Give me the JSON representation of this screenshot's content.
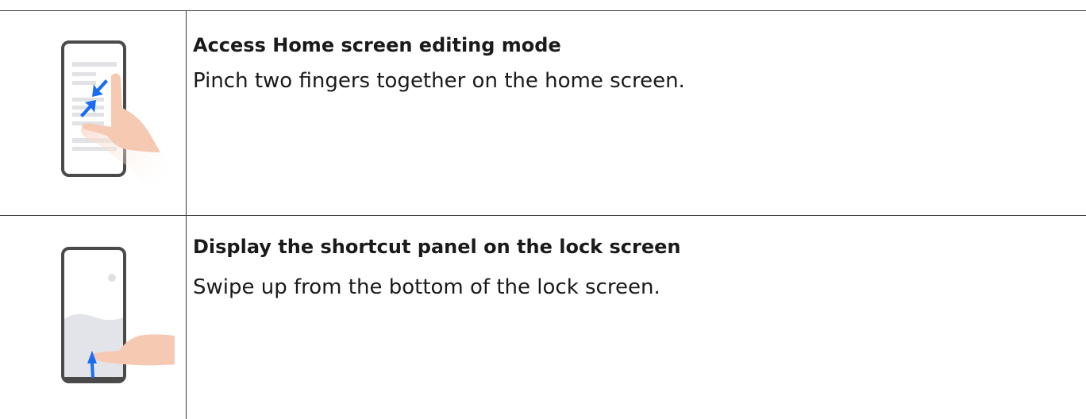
{
  "rows": [
    {
      "title": "Access Home screen editing mode",
      "description": "Pinch two fingers together on the home screen.",
      "icon": "pinch-gesture-icon"
    },
    {
      "title": "Display the shortcut panel on the lock screen",
      "description": "Swipe up from the bottom of the lock screen.",
      "icon": "swipe-up-gesture-icon"
    }
  ],
  "colors": {
    "phone_outline": "#4a4a4a",
    "screen_lines": "#e1e2e6",
    "arrow_blue": "#1a6cf5",
    "skin": "#f6c9b3",
    "lock_wave": "#e3e4ea",
    "rule": "#3a3a3a"
  }
}
